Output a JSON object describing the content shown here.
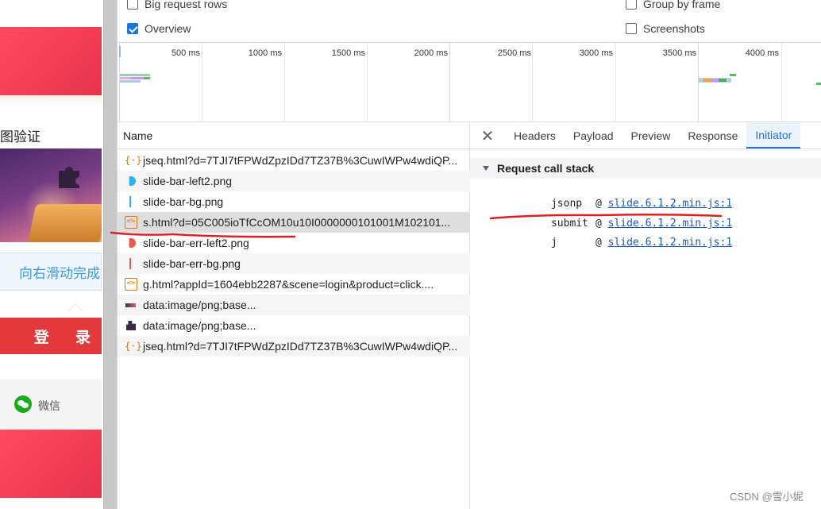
{
  "page": {
    "captcha_title": "图验证",
    "slider_text": "向右滑动完成",
    "login_label": "登 录",
    "wechat_label": "微信"
  },
  "devtools": {
    "options": {
      "big_request_rows": "Big request rows",
      "group_by_frame": "Group by frame",
      "overview": "Overview",
      "screenshots": "Screenshots",
      "overview_checked": true,
      "big_request_rows_checked": false,
      "group_by_frame_checked": false,
      "screenshots_checked": false
    },
    "timeline_ticks": [
      "500 ms",
      "1000 ms",
      "1500 ms",
      "2000 ms",
      "2500 ms",
      "3000 ms",
      "3500 ms",
      "4000 ms"
    ],
    "requests_header": "Name",
    "requests": [
      {
        "name": "jseq.html?d=7TJI7tFPWdZpzIDd7TZ37B%3CuwIWPw4wdiQP...",
        "icon": "curly-icon"
      },
      {
        "name": "slide-bar-left2.png",
        "icon": "image-blue-circle-icon"
      },
      {
        "name": "slide-bar-bg.png",
        "icon": "image-blue-bar-icon"
      },
      {
        "name": "s.html?d=05C005ioTfCcOM10u10I0000000101001M102101...",
        "icon": "document-icon",
        "selected": true
      },
      {
        "name": "slide-bar-err-left2.png",
        "icon": "image-red-circle-icon"
      },
      {
        "name": "slide-bar-err-bg.png",
        "icon": "image-red-bar-icon"
      },
      {
        "name": "g.html?appId=1604ebb2287&scene=login&product=click....",
        "icon": "document-icon"
      },
      {
        "name": "data:image/png;base...",
        "icon": "image-strip-icon"
      },
      {
        "name": "data:image/png;base...",
        "icon": "image-piece-icon"
      },
      {
        "name": "jseq.html?d=7TJI7tFPWdZpzIDd7TZ37B%3CuwIWPw4wdiQP...",
        "icon": "curly-icon"
      }
    ],
    "detail_tabs": [
      "Headers",
      "Payload",
      "Preview",
      "Response",
      "Initiator"
    ],
    "active_tab": "Initiator",
    "call_stack_title": "Request call stack",
    "call_stack": [
      {
        "fn": "jsonp",
        "at": "@",
        "source": "slide.6.1.2.min.js:1"
      },
      {
        "fn": "submit",
        "at": "@",
        "source": "slide.6.1.2.min.js:1"
      },
      {
        "fn": "j",
        "at": "@",
        "source": "slide.6.1.2.min.js:1"
      }
    ],
    "colors": {
      "accent": "#1a73e8",
      "annotation_red": "#e02020",
      "link": "#1a55c5"
    }
  },
  "watermark": "CSDN @雪小妮"
}
